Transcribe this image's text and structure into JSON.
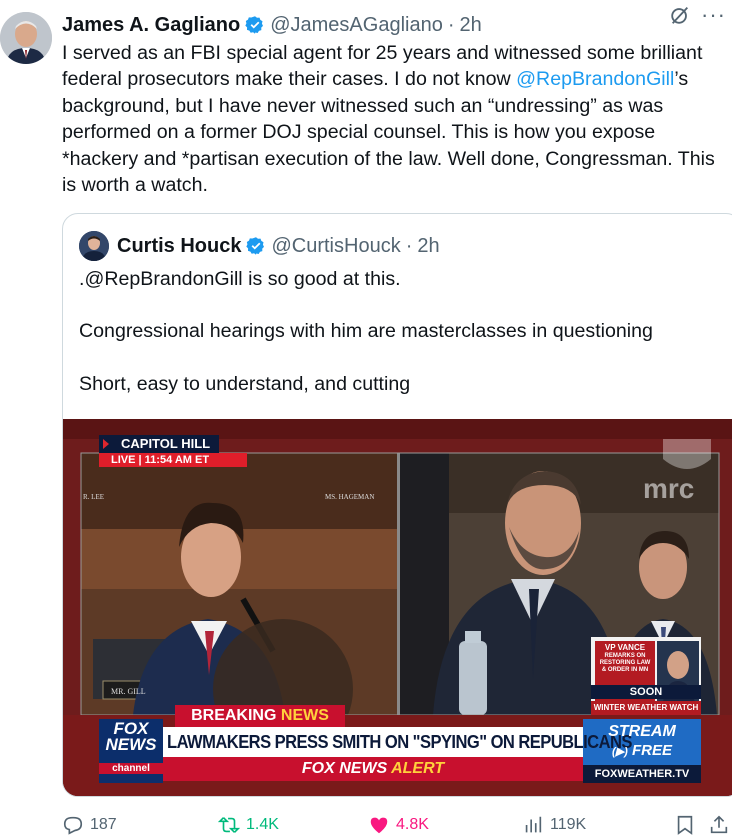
{
  "post": {
    "author_name": "James A. Gagliano",
    "handle": "@JamesAGagliano",
    "separator": "·",
    "time": "2h",
    "more_label": "···",
    "text_before_mention": "I served as an FBI special agent for 25 years and witnessed some brilliant federal prosecutors make their cases. I do not know ",
    "mention": "@RepBrandonGill",
    "text_after_mention": "’s background, but I have never witnessed such an “undressing” as was performed on a former DOJ special counsel. This is how you expose *hackery and *partisan execution of the law. Well done, Congressman. This is worth a watch."
  },
  "quoted": {
    "author_name": "Curtis Houck",
    "handle": "@CurtisHouck",
    "separator": "·",
    "time": "2h",
    "lines": [
      ".@RepBrandonGill is so good at this.",
      "Congressional hearings with him are masterclasses in questioning",
      "Short, easy to understand, and cutting"
    ]
  },
  "video": {
    "location": "CAPITOL HILL",
    "live": "LIVE",
    "time": "11:54 AM ET",
    "nameplate_left": "MR. GILL",
    "nameplate_top_right": "MS. HAGEMAN",
    "nameplate_top_left": "R. LEE",
    "breaking_word1": "BREAKING",
    "breaking_word2": "NEWS",
    "headline": "LAWMAKERS PRESS SMITH ON \"SPYING\" ON REPUBLICANS",
    "fox_line1": "FOX",
    "fox_line2": "NEWS",
    "fox_line3": "channel",
    "alert_brand": "FOX NEWS",
    "alert_word": "ALERT",
    "watermark": "mrc",
    "promo_title": "VP VANCE",
    "promo_sub": "REMARKS ON RESTORING LAW & ORDER IN MN",
    "promo_soon": "SOON",
    "weather_watch": "WINTER WEATHER WATCH",
    "stream_label": "STREAM",
    "free_label": "FREE",
    "weather_site": "FOXWEATHER.TV"
  },
  "actions": {
    "replies": "187",
    "reposts": "1.4K",
    "likes": "4.8K",
    "views": "119K"
  },
  "colors": {
    "accent_blue": "#1d9bf0",
    "like_pink": "#f91880",
    "repost_green": "#00ba7c",
    "fox_red": "#c8102e"
  },
  "icons": [
    "verified-badge-icon",
    "grok-icon",
    "more-icon",
    "reply-icon",
    "repost-icon",
    "like-icon",
    "views-icon",
    "bookmark-icon",
    "share-icon"
  ]
}
